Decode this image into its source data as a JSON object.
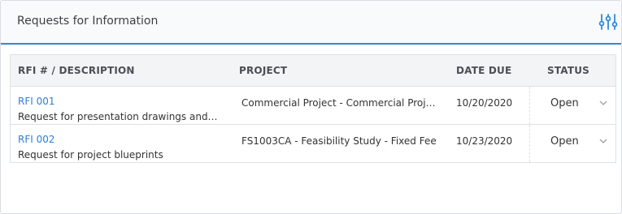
{
  "panel": {
    "title": "Requests for Information",
    "settings_icon": "sliders-icon",
    "accent_color": "#2f8ad8"
  },
  "table": {
    "columns": [
      "RFI # / DESCRIPTION",
      "PROJECT",
      "DATE DUE",
      "STATUS"
    ],
    "rows": [
      {
        "rfi_number": "RFI 001",
        "description": "Request for presentation drawings and…",
        "project": "Commercial Project - Commercial Proj…",
        "date_due": "10/20/2020",
        "status": "Open"
      },
      {
        "rfi_number": "RFI 002",
        "description": "Request for project blueprints",
        "project": "FS1003CA - Feasibility Study - Fixed Fee",
        "date_due": "10/23/2020",
        "status": "Open"
      }
    ]
  },
  "colors": {
    "link": "#2f7fd4",
    "header_bg": "#f3f4f6",
    "border": "#dde1e5"
  }
}
